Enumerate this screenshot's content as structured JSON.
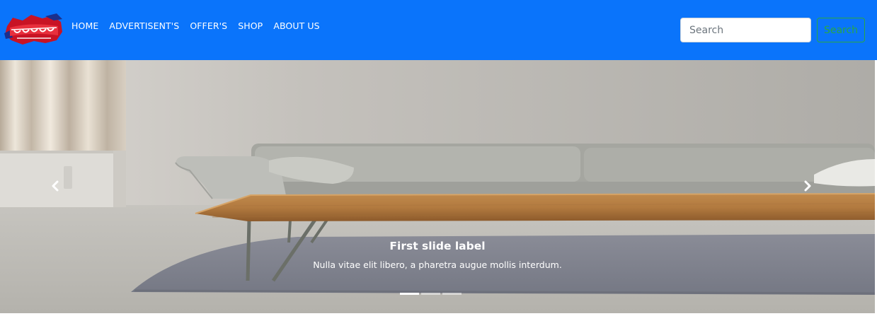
{
  "colors": {
    "navbar_bg": "#0a74fb",
    "search_button_border": "#28a745"
  },
  "navbar": {
    "logo_icon": "brand-logo-icon",
    "links": [
      {
        "label": "HOME"
      },
      {
        "label": "ADVERTISENT'S"
      },
      {
        "label": "OFFER'S"
      },
      {
        "label": "SHOP"
      },
      {
        "label": "ABOUT US"
      }
    ],
    "search": {
      "placeholder": "Search",
      "value": "",
      "button_label": "Search"
    }
  },
  "carousel": {
    "prev_icon": "chevron-left-icon",
    "next_icon": "chevron-right-icon",
    "caption": {
      "title": "First slide label",
      "text": "Nulla vitae elit libero, a pharetra augue mollis interdum."
    },
    "slide_count": 3,
    "active_slide": 1
  }
}
